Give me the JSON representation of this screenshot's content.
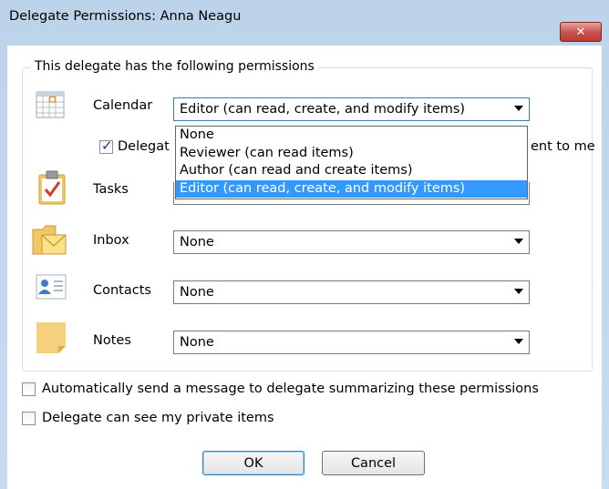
{
  "window": {
    "title": "Delegate Permissions: Anna Neagu",
    "close_icon": "close-icon",
    "close_glyph": "✕"
  },
  "group": {
    "legend": "This delegate has the following permissions"
  },
  "rows": {
    "calendar": {
      "label": "Calendar",
      "value": "Editor (can read, create, and modify items)",
      "icon": "calendar-icon"
    },
    "tasks": {
      "label": "Tasks",
      "value": "",
      "icon": "tasks-icon"
    },
    "inbox": {
      "label": "Inbox",
      "value": "None",
      "icon": "inbox-icon"
    },
    "contacts": {
      "label": "Contacts",
      "value": "None",
      "icon": "contacts-icon"
    },
    "notes": {
      "label": "Notes",
      "value": "None",
      "icon": "notes-icon"
    }
  },
  "meeting_checkbox": {
    "checked": true,
    "label_start": "Delegat",
    "label_end": "ent to me"
  },
  "calendar_dropdown_options": [
    "None",
    "Reviewer (can read items)",
    "Author (can read and create items)",
    "Editor (can read, create, and modify items)"
  ],
  "calendar_dropdown_selected_index": 3,
  "options": {
    "auto_send": {
      "checked": false,
      "label": "Automatically send a message to delegate summarizing these permissions"
    },
    "private_items": {
      "checked": false,
      "label": "Delegate can see my private items"
    }
  },
  "buttons": {
    "ok": "OK",
    "cancel": "Cancel"
  },
  "colors": {
    "selection": "#3399ff",
    "close_button": "#c75050",
    "title_bar": "#bcd3ea"
  }
}
